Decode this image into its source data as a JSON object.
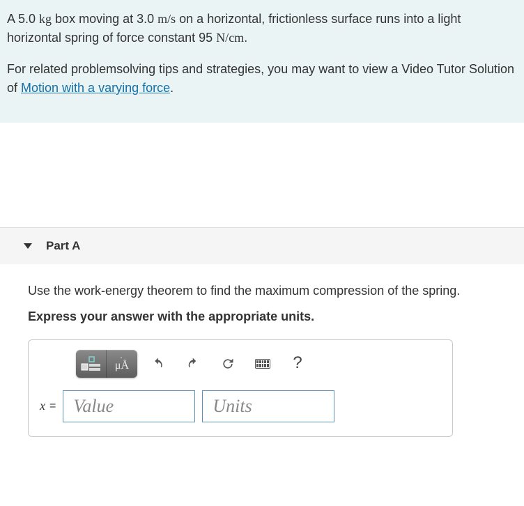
{
  "problem": {
    "p1_a": "A 5.0 ",
    "p1_unit1": "kg",
    "p1_b": " box moving at 3.0 ",
    "p1_unit2": "m/s",
    "p1_c": " on a horizontal, frictionless surface runs into a light horizontal spring of force constant 95 ",
    "p1_unit3": "N/cm",
    "p1_d": ".",
    "p2_a": "For related problemsolving tips and strategies, you may want to view a Video Tutor Solution of ",
    "p2_link": "Motion with a varying force",
    "p2_b": "."
  },
  "part": {
    "title": "Part A",
    "instruction": "Use the work-energy theorem to find the maximum compression of the spring.",
    "bold": "Express your answer with the appropriate units."
  },
  "toolbar": {
    "symbols_text": "μÅ",
    "help": "?"
  },
  "answer": {
    "var": "x",
    "eq": "=",
    "value_placeholder": "Value",
    "units_placeholder": "Units"
  }
}
